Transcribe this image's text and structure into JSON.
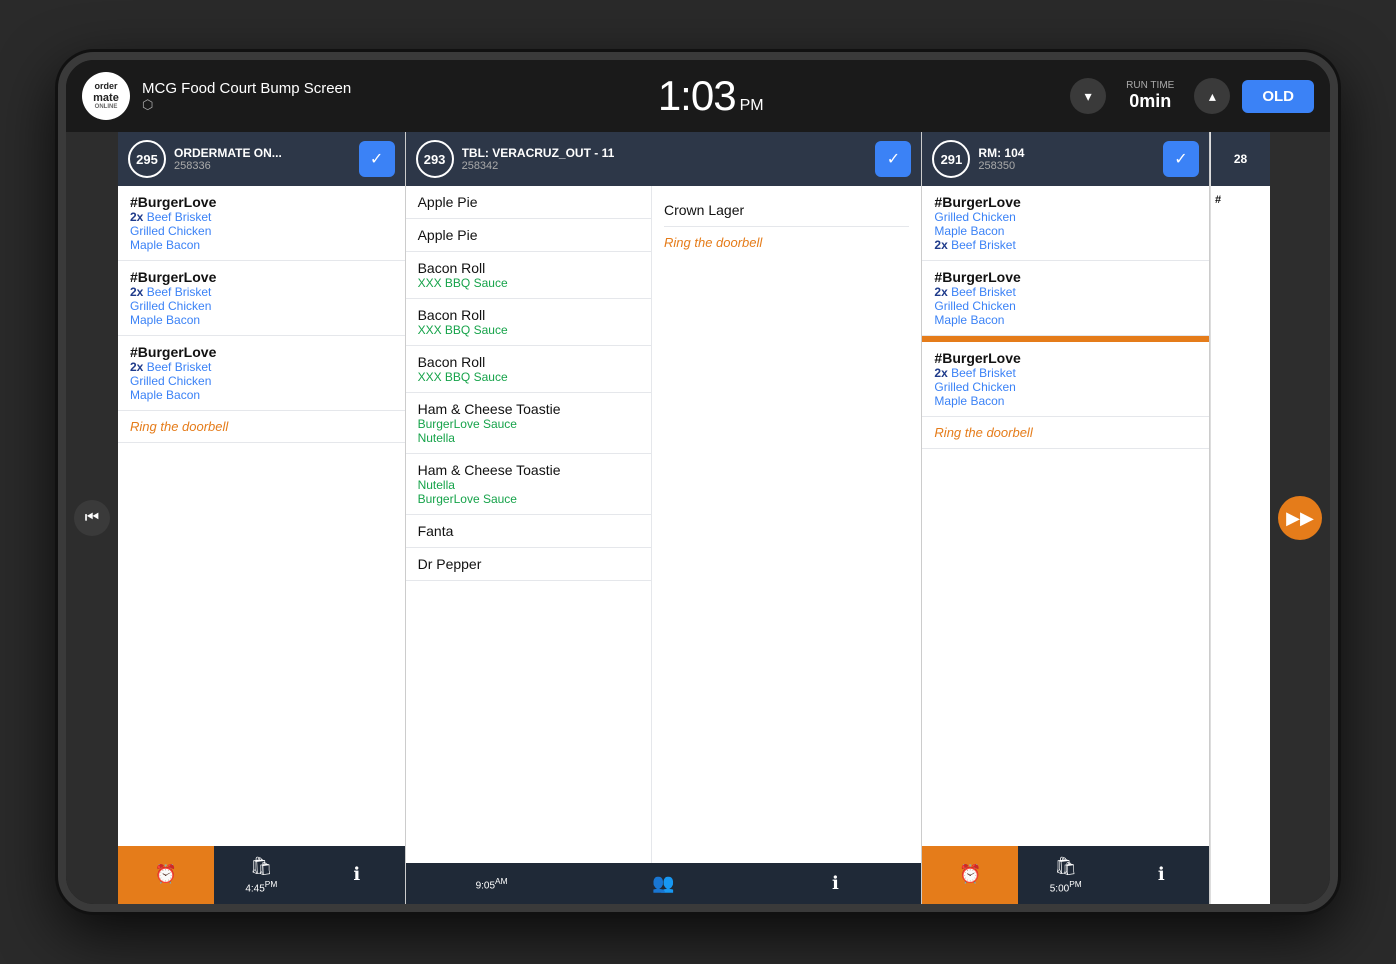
{
  "topbar": {
    "venue": "MCG Food Court Bump Screen",
    "logo_text": "ordermate",
    "logo_sub": "ONLINE",
    "clock": "1:03",
    "ampm": "PM",
    "run_time_label": "RUN TIME",
    "run_time_value": "0min",
    "old_label": "OLD"
  },
  "cards": [
    {
      "id": "card-295",
      "number": "295",
      "table": "ORDERMATE ON...",
      "sub": "258336",
      "items": [
        {
          "type": "group",
          "name": "#BurgerLove",
          "mods": [
            {
              "qty": "2x",
              "name": "Beef Brisket"
            },
            {
              "name": "Grilled Chicken"
            },
            {
              "name": "Maple Bacon"
            }
          ]
        },
        {
          "type": "group",
          "name": "#BurgerLove",
          "mods": [
            {
              "qty": "2x",
              "name": "Beef Brisket"
            },
            {
              "name": "Grilled Chicken"
            },
            {
              "name": "Maple Bacon"
            }
          ]
        },
        {
          "type": "group",
          "name": "#BurgerLove",
          "mods": [
            {
              "qty": "2x",
              "name": "Beef Brisket"
            },
            {
              "name": "Grilled Chicken"
            },
            {
              "name": "Maple Bacon"
            }
          ]
        }
      ],
      "note": "Ring the doorbell",
      "footer": {
        "time": "4:45",
        "time_sup": "PM"
      }
    },
    {
      "id": "card-293",
      "number": "293",
      "table": "TBL: VERACRUZ_OUT - 11",
      "sub": "258342",
      "left_items": [
        {
          "name": "Apple Pie",
          "mods": []
        },
        {
          "name": "Apple Pie",
          "mods": []
        },
        {
          "name": "Bacon Roll",
          "mods": [
            {
              "name": "XXX BBQ Sauce"
            }
          ]
        },
        {
          "name": "Bacon Roll",
          "mods": [
            {
              "name": "XXX BBQ Sauce"
            }
          ]
        },
        {
          "name": "Bacon Roll",
          "mods": [
            {
              "name": "XXX BBQ Sauce"
            }
          ]
        },
        {
          "name": "Ham & Cheese Toastie",
          "mods": [
            {
              "name": "BurgerLove Sauce"
            },
            {
              "name": "Nutella"
            }
          ]
        },
        {
          "name": "Ham & Cheese Toastie",
          "mods": [
            {
              "name": "Nutella"
            },
            {
              "name": "BurgerLove Sauce"
            }
          ]
        },
        {
          "name": "Fanta",
          "mods": []
        },
        {
          "name": "Dr Pepper",
          "mods": []
        }
      ],
      "right_items": [
        {
          "name": "Crown Lager",
          "mods": []
        },
        {
          "note": "Ring the doorbell"
        }
      ],
      "footer": {
        "time": "9:05",
        "time_sup": "AM"
      }
    },
    {
      "id": "card-291",
      "number": "291",
      "table": "RM: 104",
      "sub": "258350",
      "items": [
        {
          "type": "group",
          "name": "#BurgerLove",
          "mods": [
            {
              "name": "Grilled Chicken"
            },
            {
              "name": "Maple Bacon"
            },
            {
              "qty": "2x",
              "name": "Beef Brisket"
            }
          ]
        },
        {
          "type": "group",
          "name": "#BurgerLove",
          "mods": [
            {
              "qty": "2x",
              "name": "Beef Brisket"
            },
            {
              "name": "Grilled Chicken"
            },
            {
              "name": "Maple Bacon"
            }
          ]
        },
        {
          "type": "group",
          "name": "#BurgerLove",
          "mods": [
            {
              "qty": "2x",
              "name": "Beef Brisket"
            },
            {
              "name": "Grilled Chicken"
            },
            {
              "name": "Maple Bacon"
            }
          ]
        }
      ],
      "note": "Ring the doorbell",
      "footer": {
        "time": "5:00",
        "time_sup": "PM"
      }
    },
    {
      "id": "card-28x",
      "number": "28",
      "partial": true
    }
  ],
  "colors": {
    "accent_blue": "#3b82f6",
    "accent_orange": "#e57c1a",
    "dark_header": "#2d3748",
    "mod_blue": "#3b82f6",
    "mod_blue_dark": "#1e3a8a",
    "note_orange": "#e57c1a",
    "green_mod": "#16a34a"
  }
}
